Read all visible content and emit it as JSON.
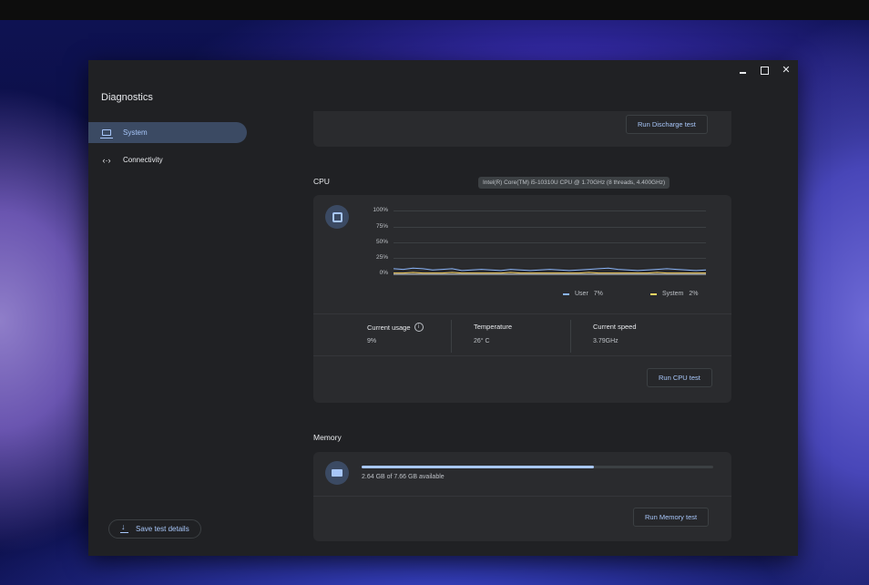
{
  "window": {
    "title": "Diagnostics"
  },
  "sidebar": {
    "items": [
      {
        "label": "System",
        "icon": "laptop-icon",
        "active": true
      },
      {
        "label": "Connectivity",
        "icon": "connectivity-icon",
        "active": false
      }
    ],
    "save_label": "Save test details"
  },
  "battery": {
    "button": "Run Discharge test"
  },
  "cpu": {
    "title": "CPU",
    "model": "Intel(R) Core(TM) i5-10310U CPU @ 1.70GHz (8 threads, 4.400GHz)",
    "y_ticks": [
      "100%",
      "75%",
      "50%",
      "25%",
      "0%"
    ],
    "legend": [
      {
        "name": "User",
        "value": "7%",
        "color": "#8ab4f8"
      },
      {
        "name": "System",
        "value": "2%",
        "color": "#fdd663"
      }
    ],
    "stats": {
      "usage_label": "Current usage",
      "usage_value": "9%",
      "temp_label": "Temperature",
      "temp_value": "26° C",
      "speed_label": "Current speed",
      "speed_value": "3.79GHz"
    },
    "button": "Run CPU test",
    "chart_data": {
      "type": "line",
      "ylim": [
        0,
        100
      ],
      "series": [
        {
          "name": "User",
          "values": [
            9,
            8,
            10,
            9,
            7,
            8,
            9,
            6,
            7,
            8,
            7,
            6,
            8,
            7,
            6,
            7,
            8,
            7,
            6,
            7,
            8,
            9,
            10,
            8,
            7,
            6,
            7,
            8,
            9,
            8,
            7,
            6,
            7
          ]
        },
        {
          "name": "System",
          "values": [
            2,
            2,
            3,
            2,
            2,
            2,
            3,
            2,
            2,
            2,
            2,
            2,
            3,
            2,
            2,
            2,
            2,
            2,
            2,
            2,
            3,
            2,
            2,
            2,
            2,
            2,
            2,
            3,
            2,
            2,
            2,
            2,
            2
          ]
        }
      ]
    }
  },
  "memory": {
    "title": "Memory",
    "usage_text": "2.64 GB of 7.66 GB available",
    "used_fraction": 0.66,
    "button": "Run Memory test"
  }
}
